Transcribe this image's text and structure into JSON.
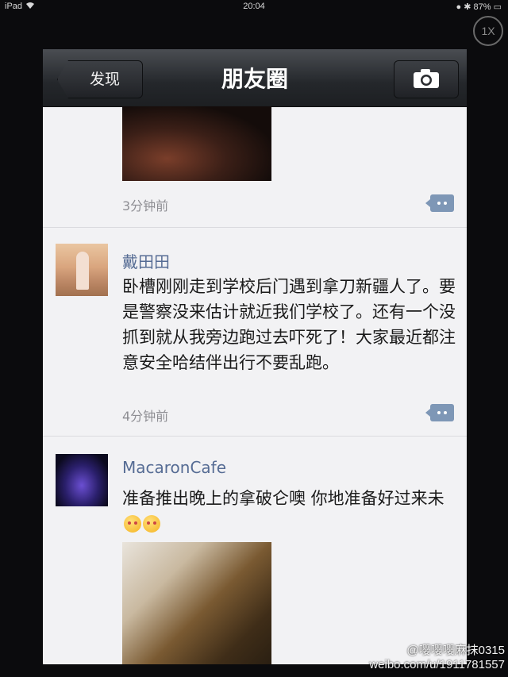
{
  "status_bar": {
    "device": "iPad",
    "wifi_icon": "wifi-icon",
    "time": "20:04",
    "battery": "87%"
  },
  "zoom_button": "1X",
  "nav": {
    "back_label": "发现",
    "title": "朋友圈",
    "camera_icon": "camera-icon"
  },
  "posts": [
    {
      "timestamp": "3分钟前"
    },
    {
      "author": "戴田田",
      "text": "卧槽刚刚走到学校后门遇到拿刀新疆人了。要是警察没来估计就近我们学校了。还有一个没抓到就从我旁边跑过去吓死了！大家最近都注意安全哈结伴出行不要乱跑。",
      "timestamp": "4分钟前"
    },
    {
      "author": "MacaronCafe",
      "text": "准备推出晚上的拿破仑噢 你地准备好过来未"
    }
  ],
  "watermark": {
    "line1": "@嘤嘤嘤麻抹0315",
    "line2": "weibo.com/u/1911781557"
  },
  "colors": {
    "nav_bg": "#24272b",
    "author_link": "#566c94",
    "comment_button": "#7e97b6",
    "feed_bg": "#f2f2f4"
  }
}
